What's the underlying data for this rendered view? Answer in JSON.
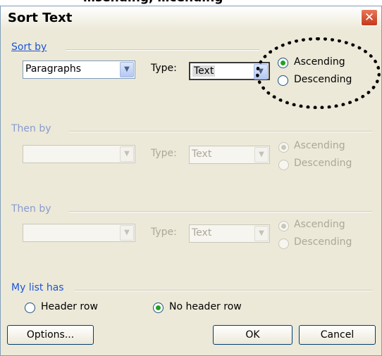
{
  "dialog": {
    "title": "Sort Text",
    "close_glyph": "✕"
  },
  "sort_by": {
    "group_label": "Sort by",
    "field_value": "Paragraphs",
    "type_label": "Type:",
    "type_value": "Text",
    "ascending_label": "Ascending",
    "descending_label": "Descending",
    "selected": "ascending"
  },
  "then_by_1": {
    "group_label": "Then by",
    "field_value": "",
    "type_label": "Type:",
    "type_value": "Text",
    "ascending_label": "Ascending",
    "descending_label": "Descending",
    "enabled": false
  },
  "then_by_2": {
    "group_label": "Then by",
    "field_value": "",
    "type_label": "Type:",
    "type_value": "Text",
    "ascending_label": "Ascending",
    "descending_label": "Descending",
    "enabled": false
  },
  "my_list_has": {
    "group_label": "My list has",
    "header_row_label": "Header row",
    "no_header_row_label": "No header row",
    "selected": "no_header_row"
  },
  "buttons": {
    "options": "Options...",
    "ok": "OK",
    "cancel": "Cancel"
  },
  "icons": {
    "combo_arrow": "chevron-down-icon",
    "close": "close-icon"
  },
  "colors": {
    "group_label": "#1d55d6",
    "radio_selected": "#21a121",
    "dialog_bg": "#ece9d8"
  }
}
